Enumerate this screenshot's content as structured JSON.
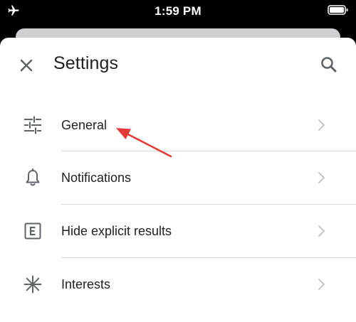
{
  "status_bar": {
    "time": "1:59 PM",
    "left_icon": "airplane-icon",
    "right_icon": "battery-icon"
  },
  "header": {
    "title": "Settings",
    "close_icon": "close-icon",
    "search_icon": "search-icon"
  },
  "menu": {
    "items": [
      {
        "label": "General",
        "icon": "sliders-icon"
      },
      {
        "label": "Notifications",
        "icon": "bell-icon"
      },
      {
        "label": "Hide explicit results",
        "icon": "explicit-icon"
      },
      {
        "label": "Interests",
        "icon": "asterisk-icon"
      }
    ]
  },
  "annotation": {
    "arrow_color": "#e53935",
    "points_to": "General"
  },
  "colors": {
    "text": "#202124",
    "icon": "#5f6368",
    "divider": "#dadce0",
    "chevron": "#c4c7c5",
    "status_bar_bg": "#000000"
  }
}
